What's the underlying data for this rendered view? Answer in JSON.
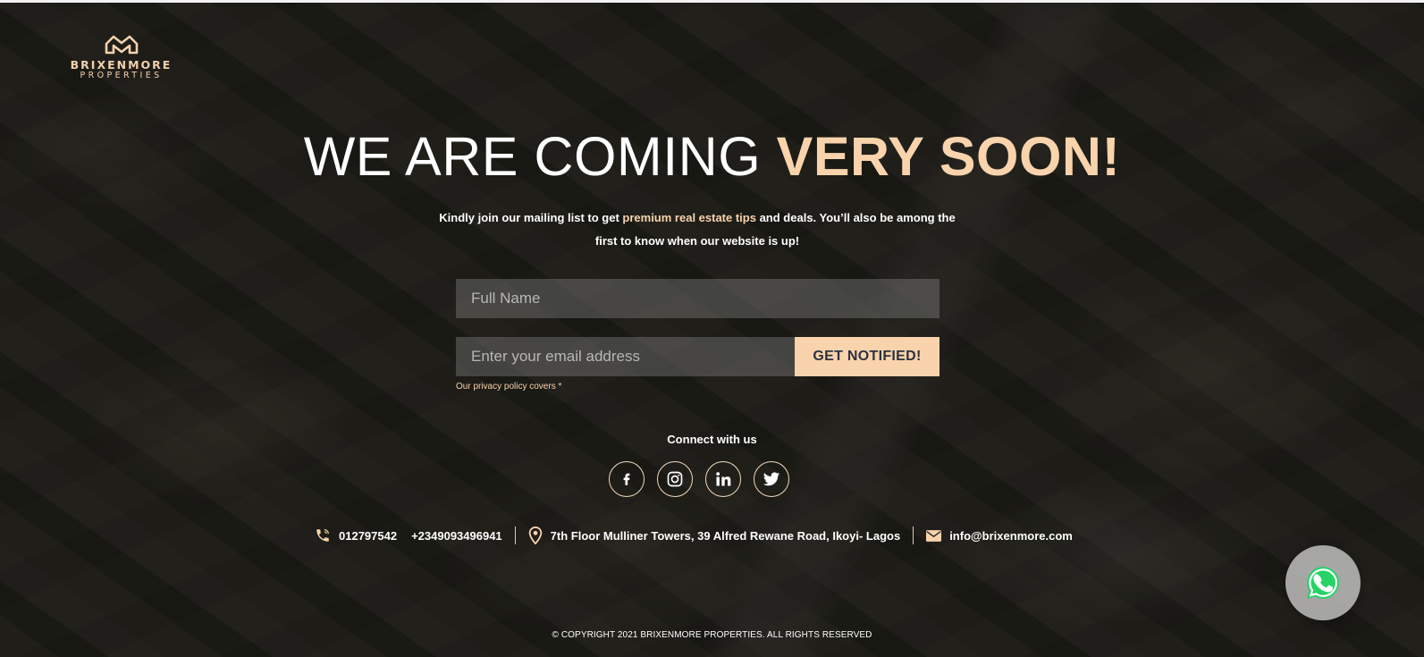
{
  "brand": {
    "name_line1": "BRIXENMORE",
    "name_line2": "PROPERTIES"
  },
  "headline": {
    "part1": "WE ARE COMING ",
    "part2": "VERY SOON!"
  },
  "intro": {
    "before": "Kindly join our mailing list to get ",
    "highlight": "premium real estate tips",
    "after": " and deals. You’ll also be among the first to know when our website is up!"
  },
  "form": {
    "name_placeholder": "Full Name",
    "email_placeholder": "Enter your email address",
    "submit_label": "GET NOTIFIED!",
    "privacy_text": "Our privacy policy covers *"
  },
  "social": {
    "heading": "Connect with us",
    "items": [
      "facebook-icon",
      "instagram-icon",
      "linkedin-icon",
      "twitter-icon"
    ]
  },
  "contact": {
    "phone1": "012797542",
    "phone2": "+2349093496941",
    "address": "7th Floor Mulliner Towers, 39 Alfred Rewane Road, Ikoyi- Lagos",
    "email": "info@brixenmore.com"
  },
  "footer": {
    "copyright": "© COPYRIGHT 2021 BRIXENMORE PROPERTIES. ALL RIGHTS RESERVED"
  },
  "colors": {
    "accent": "#f8d3ac",
    "button_text": "#2e3140",
    "whatsapp": "#25d366"
  },
  "widgets": {
    "chat_icon": "whatsapp-icon"
  }
}
